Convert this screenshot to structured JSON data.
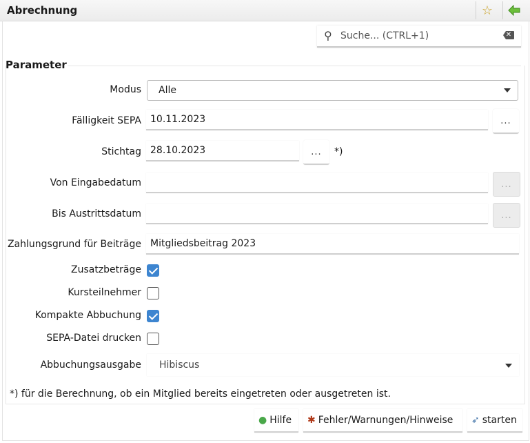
{
  "window": {
    "title": "Abrechnung",
    "favorite_icon": "star-icon",
    "back_icon": "green-arrow-left-icon"
  },
  "search": {
    "placeholder": "Suche...   (CTRL+1)"
  },
  "group": {
    "title": "Parameter"
  },
  "form": {
    "modus": {
      "label": "Modus",
      "value": "Alle"
    },
    "faelligkeit": {
      "label": "Fälligkeit SEPA",
      "value": "10.11.2023",
      "button": "..."
    },
    "stichtag": {
      "label": "Stichtag",
      "value": "28.10.2023",
      "button": "...",
      "note": "*)"
    },
    "von_eingabedatum": {
      "label": "Von Eingabedatum",
      "value": "",
      "button": "..."
    },
    "bis_austrittsdatum": {
      "label": "Bis Austrittsdatum",
      "value": "",
      "button": "..."
    },
    "zahlungsgrund": {
      "label": "Zahlungsgrund für Beiträge",
      "value": "Mitgliedsbeitrag 2023"
    },
    "zusatzbetraege": {
      "label": "Zusatzbeträge",
      "checked": true
    },
    "kursteilnehmer": {
      "label": "Kursteilnehmer",
      "checked": false
    },
    "kompakte_abbuchung": {
      "label": "Kompakte Abbuchung",
      "checked": true
    },
    "sepa_datei": {
      "label": "SEPA-Datei drucken",
      "checked": false
    },
    "abbuchungsausgabe": {
      "label": "Abbuchungsausgabe",
      "value": "Hibiscus"
    }
  },
  "footnote": "*) für die Berechnung, ob ein Mitglied bereits eingetreten oder ausgetreten ist.",
  "buttons": {
    "hilfe": "Hilfe",
    "fehler": "Fehler/Warnungen/Hinweise",
    "starten": "starten"
  },
  "colors": {
    "accent": "#3d85d0"
  }
}
